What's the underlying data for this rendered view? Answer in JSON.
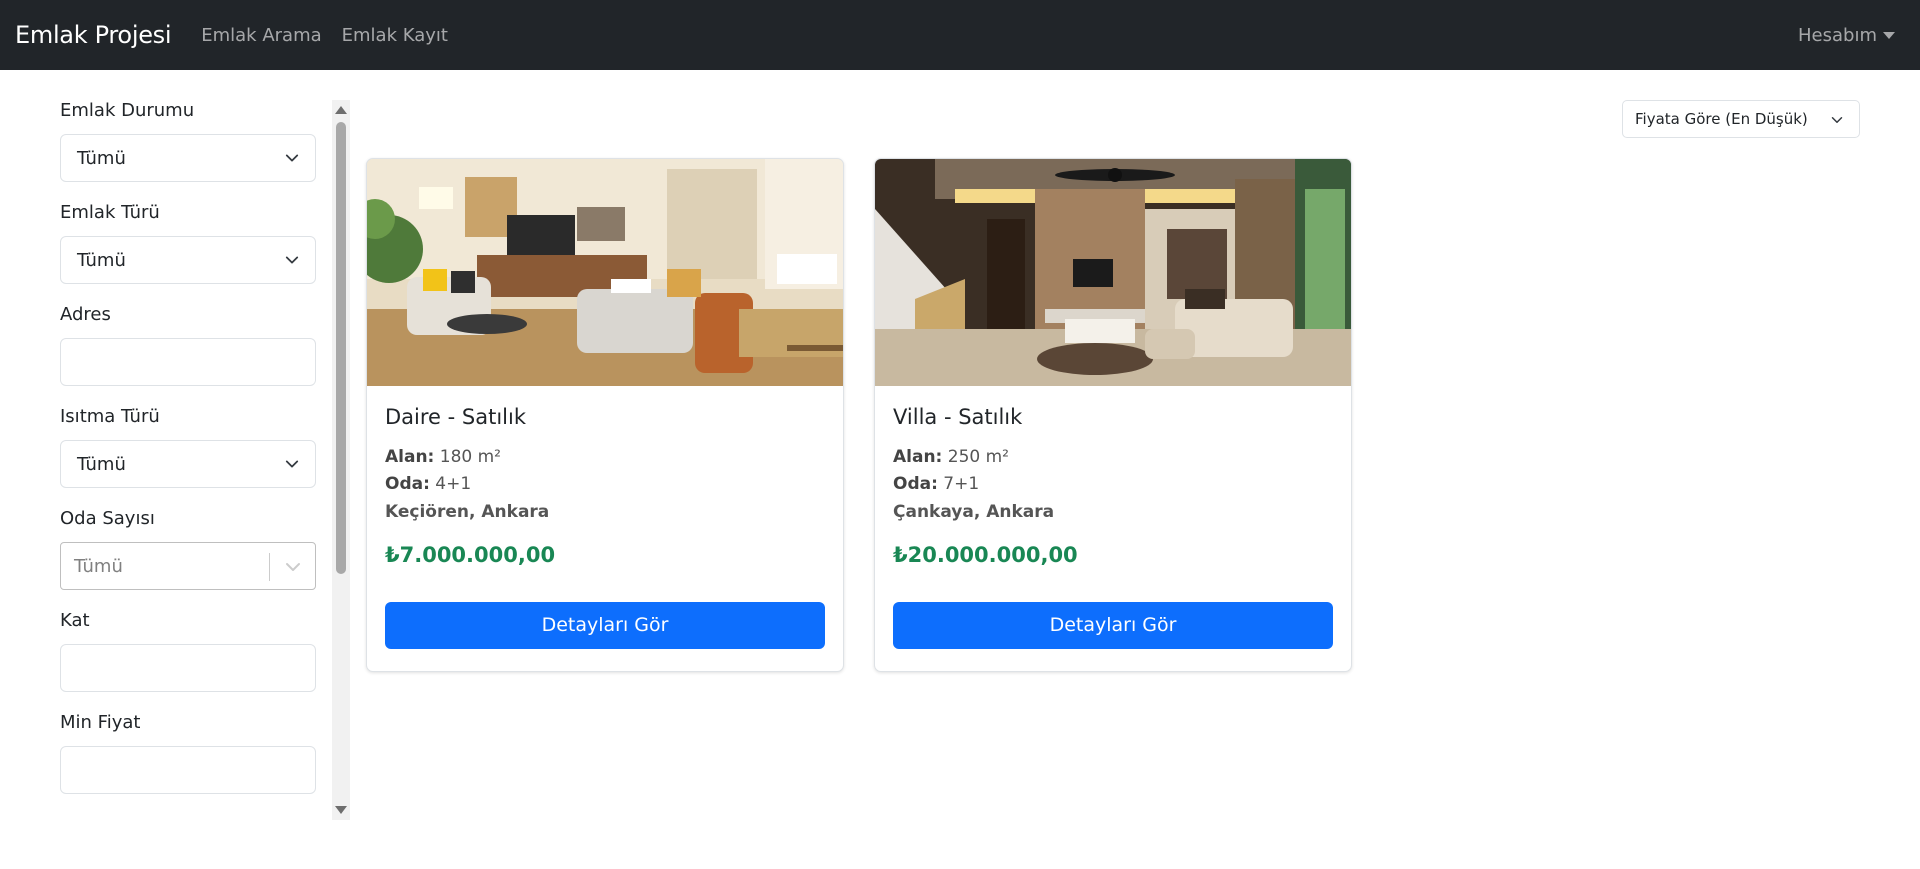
{
  "navbar": {
    "brand": "Emlak Projesi",
    "links": [
      "Emlak Arama",
      "Emlak Kayıt"
    ],
    "account": "Hesabım"
  },
  "sidebar": {
    "filters": [
      {
        "label": "Emlak Durumu",
        "type": "select",
        "value": "Tümü"
      },
      {
        "label": "Emlak Türü",
        "type": "select",
        "value": "Tümü"
      },
      {
        "label": "Adres",
        "type": "input",
        "value": ""
      },
      {
        "label": "Isıtma Türü",
        "type": "select",
        "value": "Tümü"
      },
      {
        "label": "Oda Sayısı",
        "type": "multiselect",
        "placeholder": "Tümü"
      },
      {
        "label": "Kat",
        "type": "input",
        "value": ""
      },
      {
        "label": "Min Fiyat",
        "type": "input",
        "value": ""
      }
    ]
  },
  "sort": {
    "value": "Fiyata Göre (En Düşük)"
  },
  "listings": [
    {
      "title": "Daire - Satılık",
      "area_label": "Alan:",
      "area": "180 m²",
      "rooms_label": "Oda:",
      "rooms": "4+1",
      "location": "Keçiören, Ankara",
      "price": "₺7.000.000,00",
      "button": "Detayları Gör"
    },
    {
      "title": "Villa - Satılık",
      "area_label": "Alan:",
      "area": "250 m²",
      "rooms_label": "Oda:",
      "rooms": "7+1",
      "location": "Çankaya, Ankara",
      "price": "₺20.000.000,00",
      "button": "Detayları Gör"
    }
  ],
  "colors": {
    "navbar_bg": "#212529",
    "primary": "#0d6efd",
    "price": "#198754"
  }
}
